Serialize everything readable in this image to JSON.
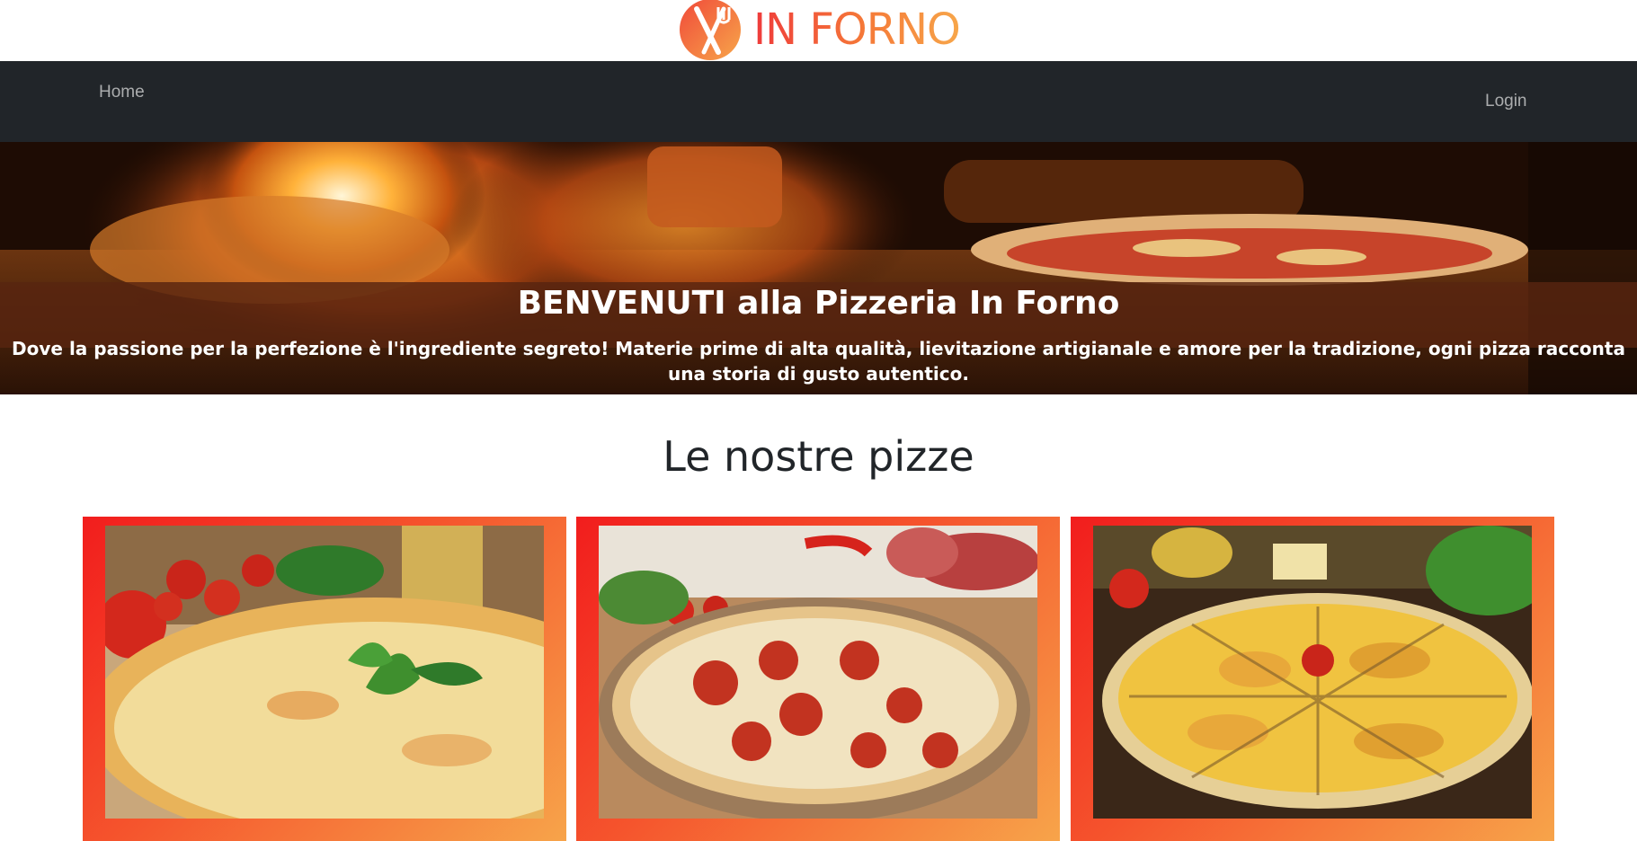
{
  "brand": {
    "name": "IN FORNO",
    "icon": "fork-knife-icon",
    "colors": [
      "#ef3b3b",
      "#f7a64a"
    ]
  },
  "navbar": {
    "home_label": "Home",
    "login_label": "Login",
    "background": "#212529"
  },
  "hero": {
    "title": "BENVENUTI alla Pizzeria In Forno",
    "text": "Dove la passione per la perfezione è l'ingrediente segreto! Materie prime di alta qualità, lievitazione artigianale e amore per la tradizione, ogni pizza racconta una storia di gusto autentico."
  },
  "section": {
    "title": "Le nostre pizze"
  },
  "cards": [
    {
      "image": "pizza-margherita-photo"
    },
    {
      "image": "pizza-pepperoni-photo"
    },
    {
      "image": "pizza-quattro-formaggi-photo"
    }
  ]
}
